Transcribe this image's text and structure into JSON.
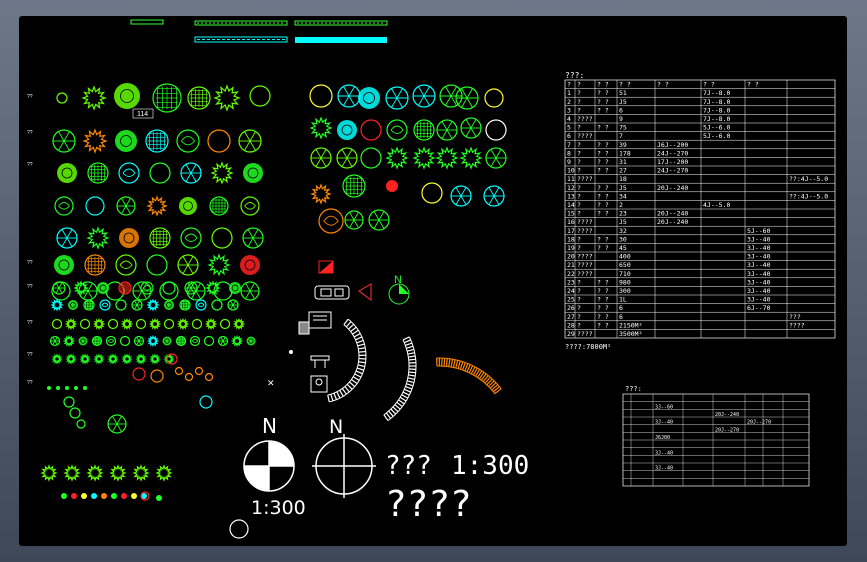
{
  "window": {
    "background": "#000000"
  },
  "colors": {
    "green": "#22ff22",
    "lime": "#66ff00",
    "cyan": "#00ffff",
    "yellow": "#ffff33",
    "red": "#ff2222",
    "orange": "#ff8800",
    "white": "#ffffff"
  },
  "legend": {
    "label_114": "114",
    "row_labels": [
      "??",
      "??",
      "??",
      "??",
      "??",
      "??",
      "??",
      "??"
    ]
  },
  "compass": {
    "n1": "N",
    "n2": "N",
    "n3": "N",
    "scale_1": "1:300",
    "text_qqq": "???",
    "text_scale": "1:300",
    "text_qqqq": "????"
  },
  "main_table": {
    "title": "???:",
    "headers": [
      "?",
      "?",
      "? ?",
      "?  ?",
      "?  ?",
      "?  ?",
      "?  ?"
    ],
    "rows": [
      [
        "1",
        "?",
        "?  ?",
        "51",
        "",
        "7J--8.0",
        "",
        ""
      ],
      [
        "2",
        "?",
        "?  ?",
        "J5",
        "",
        "7J--8.0",
        "",
        ""
      ],
      [
        "3",
        "?",
        "?  ?",
        "6",
        "",
        "7J--8.0",
        "",
        ""
      ],
      [
        "4",
        "????",
        "",
        "9",
        "",
        "7J--8.0",
        "",
        ""
      ],
      [
        "5",
        "?",
        "?  ?",
        "75",
        "",
        "5J--6.0",
        "",
        ""
      ],
      [
        "6",
        "????",
        "",
        "7",
        "",
        "5J--6.0",
        "",
        ""
      ],
      [
        "7",
        "?",
        "?  ?",
        "39",
        "J6J--200",
        "",
        "",
        ""
      ],
      [
        "8",
        "?",
        "?  ?",
        "178",
        "24J--270",
        "",
        "",
        ""
      ],
      [
        "9",
        "?",
        "?  ?",
        "31",
        "17J--200",
        "",
        "",
        ""
      ],
      [
        "10",
        "?",
        "?  ?",
        "27",
        "24J--270",
        "",
        "",
        ""
      ],
      [
        "11",
        "????",
        "",
        "18",
        "",
        "",
        "",
        "??:4J--5.0"
      ],
      [
        "12",
        "?",
        "?  ?",
        "J5",
        "20J--240",
        "",
        "",
        ""
      ],
      [
        "13",
        "?",
        "?  ?",
        "34",
        "",
        "",
        "",
        "??:4J--5.0"
      ],
      [
        "14",
        "?",
        "?  ?",
        "2",
        "",
        "4J--5.0",
        "",
        ""
      ],
      [
        "15",
        "?",
        "?  ?",
        "23",
        "20J--240",
        "",
        "",
        ""
      ],
      [
        "16",
        "????",
        "",
        "J5",
        "20J--240",
        "",
        "",
        ""
      ],
      [
        "17",
        "????",
        "",
        "32",
        "",
        "",
        "5J--60",
        ""
      ],
      [
        "18",
        "?",
        "?  ?",
        "30",
        "",
        "",
        "3J--40",
        ""
      ],
      [
        "19",
        "?",
        "?  ?",
        "45",
        "",
        "",
        "3J--40",
        ""
      ],
      [
        "20",
        "????",
        "",
        "400",
        "",
        "",
        "3J--40",
        ""
      ],
      [
        "21",
        "????",
        "",
        "650",
        "",
        "",
        "3J--40",
        ""
      ],
      [
        "22",
        "????",
        "",
        "710",
        "",
        "",
        "3J--40",
        ""
      ],
      [
        "23",
        "?",
        "?  ?",
        "980",
        "",
        "",
        "3J--40",
        ""
      ],
      [
        "24",
        "?",
        "?  ?",
        "300",
        "",
        "",
        "3J--40",
        ""
      ],
      [
        "25",
        "?",
        "?  ?",
        "1L",
        "",
        "",
        "3J--40",
        ""
      ],
      [
        "26",
        "?",
        "?  ?",
        "6",
        "",
        "",
        "6J--70",
        ""
      ],
      [
        "27",
        "?",
        "?  ?",
        "6",
        "",
        "",
        "",
        "???"
      ],
      [
        "28",
        "?",
        "?  ?",
        "2150M²",
        "",
        "",
        "",
        "????"
      ],
      [
        "29",
        "????",
        "",
        "3500M²",
        "",
        "",
        "",
        ""
      ]
    ],
    "footer": "????:7800M²"
  },
  "small_table": {
    "title": "???:",
    "cells": [
      "3J--60",
      "3J--40",
      "20J--240",
      "J6J00",
      "3J--40",
      "20J--270",
      "20J--270",
      "3J--40"
    ]
  }
}
